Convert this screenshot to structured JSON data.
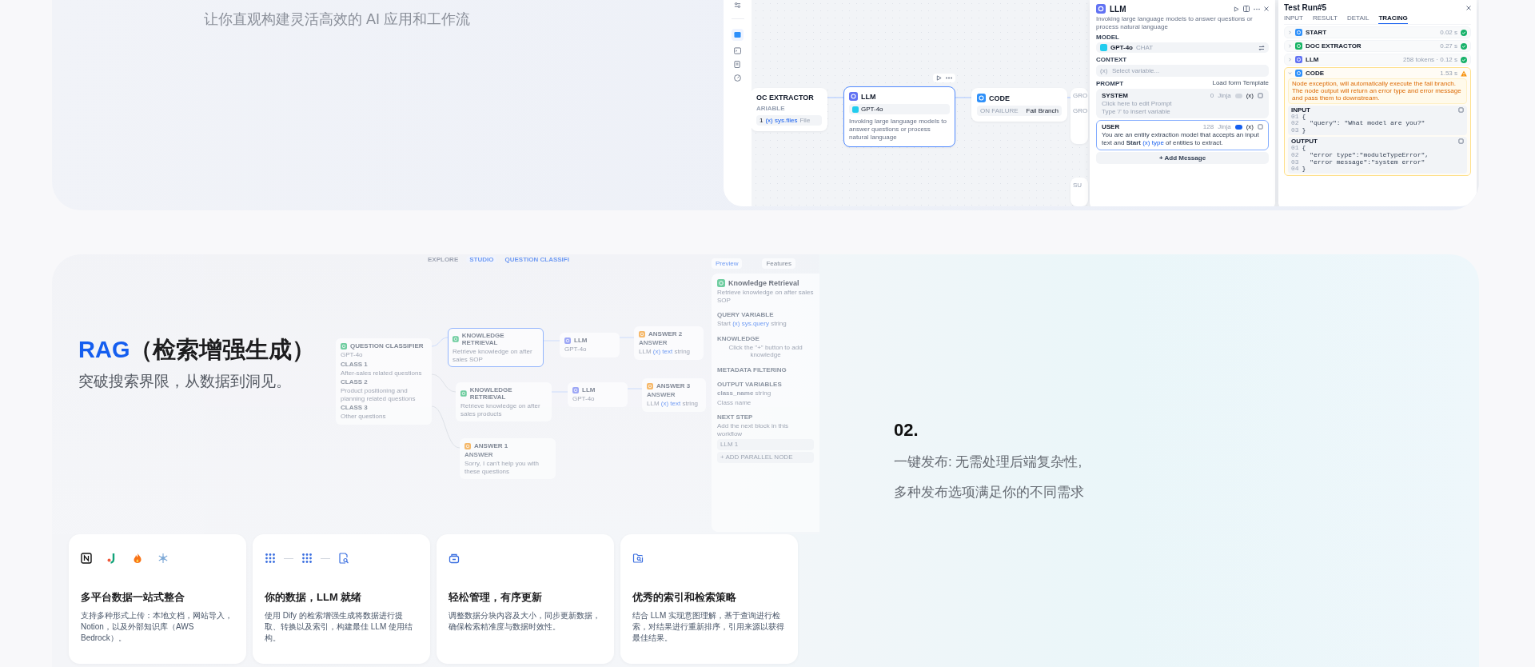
{
  "hero": {
    "subtitle": "让你直观构建灵活高效的 AI 应用和工作流"
  },
  "workflow_demo": {
    "canvas_nodes": [
      {
        "kind": "doc_extractor",
        "title": "OC EXTRACTOR",
        "field_label": "ARIABLE",
        "index": "1",
        "variable": "(x) sys.files",
        "type": "File",
        "selected": false
      },
      {
        "kind": "llm",
        "title": "LLM",
        "model": "GPT-4o",
        "description": "Invoking large language models to answer questions or process natural language",
        "selected": true
      },
      {
        "kind": "code",
        "title": "CODE",
        "field_label": "ON FAILURE",
        "value": "Fail Branch",
        "selected": false
      }
    ],
    "partial_nodes": [
      {
        "labels": [
          "GRO",
          "GRO"
        ]
      },
      {
        "labels": [
          "SU"
        ]
      }
    ],
    "llm_panel": {
      "title": "LLM",
      "description": "Invoking large language models to answer questions or process natural language",
      "model_label": "MODEL",
      "model": "GPT-4o",
      "model_tag": "CHAT",
      "context_label": "CONTEXT",
      "context_prefix": "(x)",
      "context_placeholder": "Select variable...",
      "prompt_label": "PROMPT",
      "template_link": "Load form Template",
      "messages": [
        {
          "role": "SYSTEM",
          "count": "0",
          "jinja": "Jinja",
          "jinja_on": false,
          "insert_label": "(x)",
          "focused": false,
          "placeholder": "Click here to edit Prompt\nType '/' to insert variable"
        },
        {
          "role": "USER",
          "count": "128",
          "jinja": "Jinja",
          "jinja_on": true,
          "insert_label": "(x)",
          "focused": true,
          "text": "You are an entity extraction model that accepts an input text and",
          "ref_node": "Start",
          "ref_variable": "(x) type",
          "text_end": "of entities to extract."
        }
      ],
      "add_button": "+ Add Message"
    },
    "test_run": {
      "title": "Test Run#5",
      "tabs": [
        {
          "label": "INPUT",
          "selected": false
        },
        {
          "label": "RESULT",
          "selected": false
        },
        {
          "label": "DETAIL",
          "selected": false
        },
        {
          "label": "TRACING",
          "selected": true
        }
      ],
      "traces": [
        {
          "kind": "start",
          "name": "START",
          "meta": "0.02 s",
          "warning": false,
          "expanded": false
        },
        {
          "kind": "doc_extractor",
          "name": "DOC EXTRACTOR",
          "meta": "0.27 s",
          "warning": false,
          "expanded": false
        },
        {
          "kind": "llm",
          "name": "LLM",
          "meta": "258 tokens · 0.12 s",
          "warning": false,
          "expanded": false
        },
        {
          "kind": "code",
          "name": "CODE",
          "meta": "1.53 s",
          "warning": true,
          "expanded": true,
          "message": "Node exception, will automatically execute the fail branch. The node output will return an error type and error message and pass them to downstream.",
          "blocks": [
            {
              "label": "INPUT",
              "lines": [
                {
                  "no": "01",
                  "code": "{"
                },
                {
                  "no": "02",
                  "code": "  \"query\": \"What model are you?\""
                },
                {
                  "no": "03",
                  "code": "}"
                }
              ]
            },
            {
              "label": "OUTPUT",
              "lines": [
                {
                  "no": "01",
                  "code": "{"
                },
                {
                  "no": "02",
                  "code": "  \"error type\":\"moduleTypeError\","
                },
                {
                  "no": "03",
                  "code": "  \"error message\":\"system error\""
                },
                {
                  "no": "04",
                  "code": "}"
                }
              ]
            }
          ]
        }
      ]
    }
  },
  "rag": {
    "title_accent": "RAG",
    "title_rest": "（检索增强生成）",
    "subtitle": "突破搜索界限，从数据到洞见。"
  },
  "rag_demo": {
    "nav": [
      {
        "label": "EXPLORE",
        "selected": false
      },
      {
        "label": "STUDIO",
        "selected": true
      }
    ],
    "breadcrumb": "QUESTION CLASSIFI",
    "preview": "Preview",
    "features": "Features",
    "nodes": [
      {
        "kind": "classifier",
        "title": "QUESTION CLASSIFIER",
        "model": "GPT-4o",
        "selected": false,
        "classes": [
          {
            "label": "CLASS 1",
            "text": "After-sales related questions"
          },
          {
            "label": "CLASS 2",
            "text": "Product positioning and planning related questions"
          },
          {
            "label": "CLASS 3",
            "text": "Other questions"
          }
        ]
      },
      {
        "kind": "knowledge",
        "title": "KNOWLEDGE RETRIEVAL",
        "description": "Retrieve knowledge on after sales SOP",
        "selected": true
      },
      {
        "kind": "llm",
        "title": "LLM",
        "model": "GPT-4o",
        "selected": false
      },
      {
        "kind": "answer",
        "title": "ANSWER 2",
        "field_label": "ANSWER",
        "source": "LLM",
        "variable": "(x) text",
        "type": "string",
        "selected": false
      },
      {
        "kind": "knowledge",
        "title": "KNOWLEDGE RETRIEVAL",
        "description": "Retrieve knowledge on after sales products",
        "selected": false
      },
      {
        "kind": "llm",
        "title": "LLM",
        "model": "GPT-4o",
        "selected": false
      },
      {
        "kind": "answer",
        "title": "ANSWER 3",
        "field_label": "ANSWER",
        "source": "LLM",
        "variable": "(x) text",
        "type": "string",
        "selected": false
      },
      {
        "kind": "answer_text",
        "title": "ANSWER 1",
        "field_label": "ANSWER",
        "text": "Sorry, I can't help you with these questions",
        "selected": false
      }
    ],
    "panel": {
      "title": "Knowledge Retrieval",
      "description": "Retrieve knowledge on after sales SOP",
      "query_label": "QUERY VARIABLE",
      "query_node": "Start",
      "query_variable": "(x) sys.query",
      "query_type": "string",
      "knowledge_label": "KNOWLEDGE",
      "knowledge_hint": "Click the \"+\" button to add knowledge",
      "metadata_label": "METADATA FILTERING",
      "output_label": "OUTPUT VARIABLES",
      "output_name": "class_name",
      "output_type": "string",
      "output_desc": "Class name",
      "next_label": "NEXT STEP",
      "next_hint": "Add the next block in this workflow",
      "next_node": "LLM 1",
      "parallel": "+ ADD PARALLEL NODE"
    }
  },
  "cards": [
    {
      "kind": "sources",
      "title": "多平台数据一站式整合",
      "text": "支持多种形式上传：本地文档，网站导入，Notion，以及外部知识库（AWS Bedrock）。"
    },
    {
      "kind": "pipeline",
      "title": "你的数据，LLM 就绪",
      "text": "使用 Dify 的检索增强生成将数据进行提取、转换以及索引，构建最佳 LLM 使用结构。"
    },
    {
      "kind": "manage",
      "title": "轻松管理，有序更新",
      "text": "调整数据分块内容及大小，同步更新数据，确保检索精准度与数据时效性。"
    },
    {
      "kind": "strategy",
      "title": "优秀的索引和检索策略",
      "text": "结合 LLM 实现意图理解，基于查询进行检索，对结果进行重新排序，引用来源以获得最佳结果。"
    }
  ],
  "feature": {
    "number": "02.",
    "lines": [
      "一键发布: 无需处理后端复杂性,",
      "多种发布选项满足你的不同需求"
    ]
  }
}
